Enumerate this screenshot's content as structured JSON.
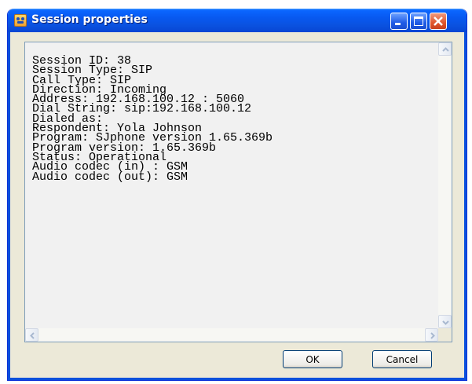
{
  "window": {
    "title": "Session properties",
    "icon": "session-app-icon",
    "controls": [
      "minimize-icon",
      "maximize-icon",
      "close-icon"
    ]
  },
  "details": {
    "lines": [
      "Session ID: 38",
      "Session Type: SIP",
      "Call Type: SIP",
      "Direction: Incoming",
      "Address: 192.168.100.12 : 5060",
      "Dial String: sip:192.168.100.12",
      "Dialed as:",
      "Respondent: Yola Johnson",
      "Program: SJphone version 1.65.369b",
      "Program version: 1.65.369b",
      "Status: Operational",
      "Audio codec (in) : GSM",
      "Audio codec (out): GSM"
    ]
  },
  "buttons": {
    "ok_label": "OK",
    "cancel_label": "Cancel"
  },
  "colors": {
    "titlebar": "#0a52e0",
    "dialog_bg": "#ece9d8",
    "close_button": "#e0552b"
  }
}
